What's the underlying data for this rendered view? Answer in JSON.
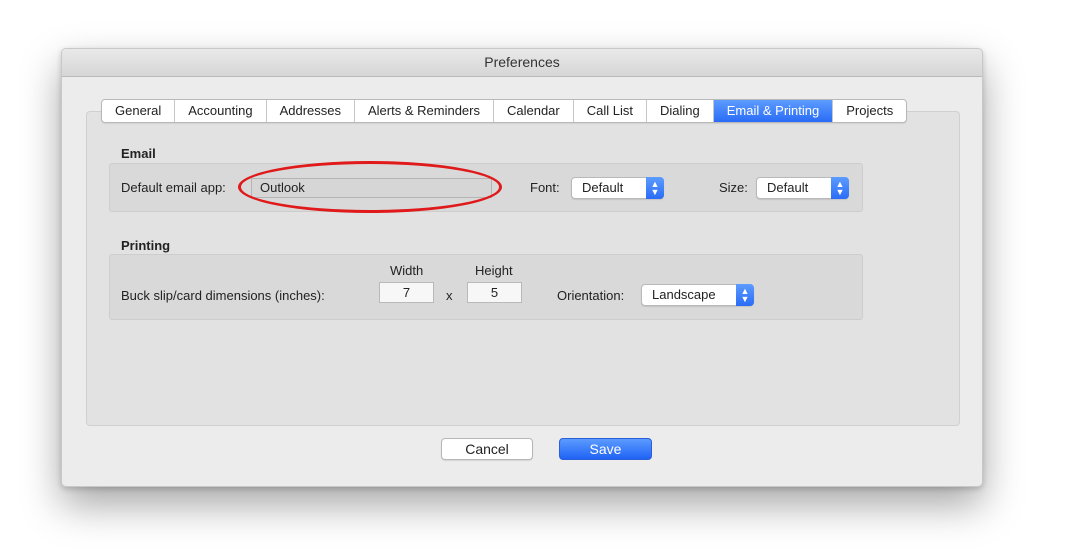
{
  "window": {
    "title": "Preferences"
  },
  "tabs": [
    {
      "label": "General",
      "active": false
    },
    {
      "label": "Accounting",
      "active": false
    },
    {
      "label": "Addresses",
      "active": false
    },
    {
      "label": "Alerts & Reminders",
      "active": false
    },
    {
      "label": "Calendar",
      "active": false
    },
    {
      "label": "Call List",
      "active": false
    },
    {
      "label": "Dialing",
      "active": false
    },
    {
      "label": "Email & Printing",
      "active": true
    },
    {
      "label": "Projects",
      "active": false
    }
  ],
  "email": {
    "section_title": "Email",
    "default_app_label": "Default email app:",
    "default_app_value": "Outlook",
    "font_label": "Font:",
    "font_value": "Default",
    "size_label": "Size:",
    "size_value": "Default"
  },
  "printing": {
    "section_title": "Printing",
    "dimensions_label": "Buck slip/card dimensions (inches):",
    "width_label": "Width",
    "height_label": "Height",
    "width_value": "7",
    "times_symbol": "x",
    "height_value": "5",
    "orientation_label": "Orientation:",
    "orientation_value": "Landscape"
  },
  "buttons": {
    "cancel_label": "Cancel",
    "save_label": "Save"
  },
  "colors": {
    "accent": "#2a6cf6",
    "annotation": "#e0191a"
  },
  "icons": {
    "popup_arrows": "up-down-chevron-icon"
  }
}
